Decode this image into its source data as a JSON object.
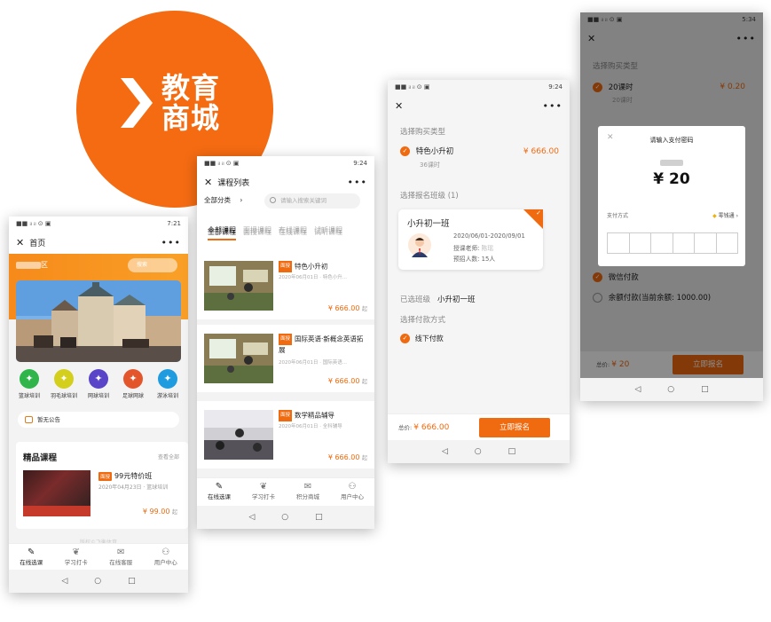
{
  "brand": {
    "title_line1": "教育",
    "title_line2": "商城"
  },
  "statusbar": {
    "p1_time": "7:21",
    "p2_time": "9:24",
    "p3_time": "9:24",
    "p4_time": "5:34",
    "icons": "■■ ᵢₗ ᵢₗ ⊙ ▣"
  },
  "system_nav": {
    "back": "◁",
    "home": "○",
    "recent": "□"
  },
  "phone1": {
    "title": "首页",
    "location_suffix": "区",
    "search_placeholder": "搜索",
    "categories": [
      {
        "label": "篮球培训",
        "color": "#2fb54a",
        "glyph": "⛹"
      },
      {
        "label": "羽毛球培训",
        "color": "#d4cf1c",
        "glyph": "🏸"
      },
      {
        "label": "网球培训",
        "color": "#5a44c8",
        "glyph": "🎾"
      },
      {
        "label": "足球网球",
        "color": "#e3562c",
        "glyph": "⚽"
      },
      {
        "label": "游泳培训",
        "color": "#1f9be0",
        "glyph": "🏊"
      }
    ],
    "notice": "暂无公告",
    "section_title": "精品课程",
    "section_more": "查看全部",
    "course": {
      "tag": "面授",
      "title": "99元特价班",
      "meta": "2020年04月23日 · 篮球培训",
      "price": "¥ 99.00",
      "price_suffix": "起"
    },
    "footer_faint": "版权©飞衡体育",
    "tabs": [
      {
        "label": "在线选课",
        "icon": "✎"
      },
      {
        "label": "学习打卡",
        "icon": "❦"
      },
      {
        "label": "在线客服",
        "icon": "✉"
      },
      {
        "label": "用户中心",
        "icon": "⚇"
      }
    ]
  },
  "phone2": {
    "title": "课程列表",
    "filter_label": "全部分类",
    "search_placeholder": "请输入搜索关键词",
    "tabs": [
      "全部课程",
      "面授课程",
      "在线课程",
      "试听课程"
    ],
    "courses": [
      {
        "tag": "面授",
        "title": "特色小升初",
        "meta": "2020年06月01日 · 特色小升...",
        "price": "¥ 666.00",
        "suffix": "起"
      },
      {
        "tag": "面授",
        "title": "国际英语·新概念英语拓展",
        "meta": "2020年06月01日 · 国际英语...",
        "price": "¥ 666.00",
        "suffix": "起"
      },
      {
        "tag": "面授",
        "title": "数学精品辅导",
        "meta": "2020年06月01日 · 全科辅导",
        "price": "¥ 666.00",
        "suffix": "起"
      }
    ],
    "bottom_tabs": [
      {
        "label": "在线选课",
        "icon": "✎"
      },
      {
        "label": "学习打卡",
        "icon": "❦"
      },
      {
        "label": "积分商城",
        "icon": "✉"
      },
      {
        "label": "用户中心",
        "icon": "⚇"
      }
    ]
  },
  "phone3": {
    "section_type": "选择购买类型",
    "course_name": "特色小升初",
    "course_sub": "36课时",
    "course_price": "¥ 666.00",
    "section_class": "选择报名班级 (1)",
    "class_name": "小升初一班",
    "class_date": "2020/06/01-2020/09/01",
    "class_teacher_label": "授课老师: ",
    "class_teacher": "陈瑶",
    "class_quota": "预招人数: 15人",
    "selected_label": "已选班级",
    "selected_value": "小升初一班",
    "section_pay": "选择付款方式",
    "pay_offline": "线下付款",
    "total_label": "总价:",
    "total_value": "¥ 666.00",
    "submit": "立即报名"
  },
  "phone4": {
    "section_type": "选择购买类型",
    "course_name": "20课时",
    "course_sub": "20课时",
    "course_price": "¥ 0.20",
    "dialog_title": "请输入支付密码",
    "dialog_amount": "¥ 20",
    "pay_method_label": "支付方式",
    "pay_method_value": "零钱通",
    "option_wechat": "微信付款",
    "option_balance": "余额付款(当前余额: 1000.00)",
    "total_label": "总价:",
    "total_value": "¥ 20",
    "submit": "立即报名"
  }
}
